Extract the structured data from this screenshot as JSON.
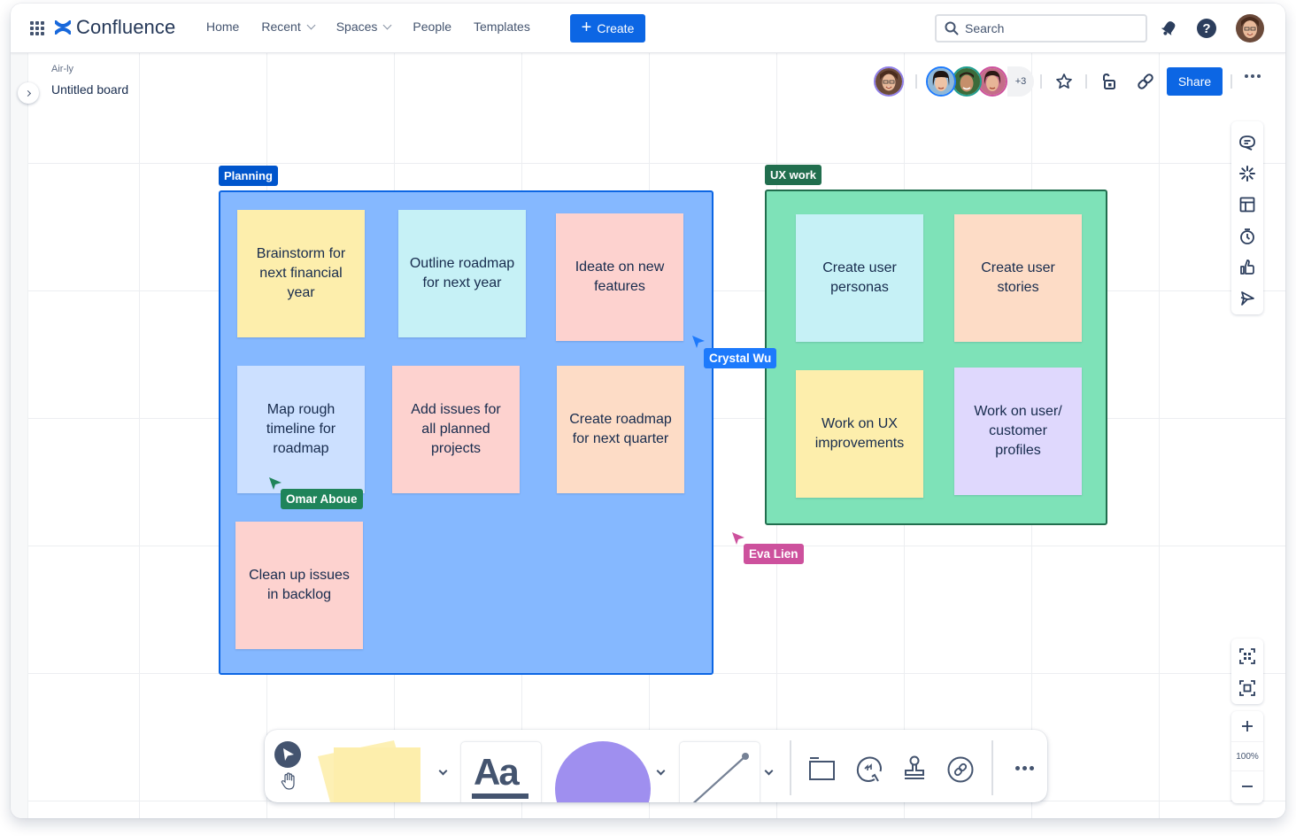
{
  "topnav": {
    "app_name": "Confluence",
    "items": [
      {
        "label": "Home",
        "has_dropdown": false
      },
      {
        "label": "Recent",
        "has_dropdown": true
      },
      {
        "label": "Spaces",
        "has_dropdown": true
      },
      {
        "label": "People",
        "has_dropdown": false
      },
      {
        "label": "Templates",
        "has_dropdown": false
      }
    ],
    "create_label": "Create",
    "search_placeholder": "Search",
    "icons": [
      "apps-grid-icon",
      "confluence-logo-icon",
      "notifications-icon",
      "help-icon",
      "profile-avatar"
    ]
  },
  "board": {
    "space_name": "Air-ly",
    "title": "Untitled board",
    "collaborators_more": "+3",
    "share_label": "Share"
  },
  "frames": [
    {
      "label": "Planning",
      "color": "#85b8ff",
      "border": "#0c66e4",
      "label_bg": "#0055cc",
      "stickies": [
        {
          "text": "Brainstorm for next financial year",
          "color": "#fdeeac"
        },
        {
          "text": "Outline roadmap for next year",
          "color": "#c6f1f6"
        },
        {
          "text": "Ideate on new features",
          "color": "#fdd2cf"
        },
        {
          "text": "Map rough timeline for roadmap",
          "color": "#cce0ff"
        },
        {
          "text": "Add issues for all planned projects",
          "color": "#fdd2cf"
        },
        {
          "text": "Create roadmap for next quarter",
          "color": "#fddcc6"
        },
        {
          "text": "Clean up issues in backlog",
          "color": "#fdd2cf"
        }
      ]
    },
    {
      "label": "UX work",
      "color": "#7ee2b8",
      "border": "#216e4e",
      "label_bg": "#216e4e",
      "stickies": [
        {
          "text": "Create user personas",
          "color": "#c6f1f6"
        },
        {
          "text": "Create user stories",
          "color": "#fddcc6"
        },
        {
          "text": "Work on UX improvements",
          "color": "#fdeeac"
        },
        {
          "text": "Work on user/ customer profiles",
          "color": "#dfd8fd"
        }
      ]
    }
  ],
  "cursors": [
    {
      "name": "Crystal Wu",
      "color": "#1d7afc"
    },
    {
      "name": "Omar Aboue",
      "color": "#1f845a"
    },
    {
      "name": "Eva Lien",
      "color": "#cd519d"
    }
  ],
  "zoom": {
    "level": "100%"
  },
  "side_tools": [
    "comment-icon",
    "sparkle-icon",
    "template-icon",
    "timer-icon",
    "vote-icon",
    "pin-icon"
  ],
  "bottom_tools": [
    "select-tool",
    "hand-tool",
    "sticky-note-tool",
    "text-tool",
    "shape-tool",
    "line-tool",
    "frame-tool",
    "smart-link-tool",
    "stamp-tool",
    "link-tool",
    "more-tools"
  ]
}
